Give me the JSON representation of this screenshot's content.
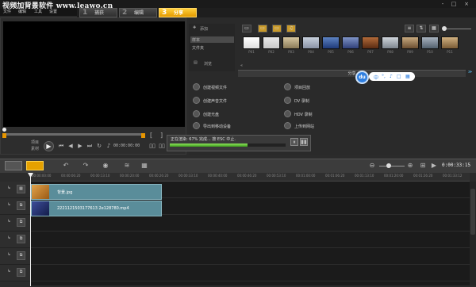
{
  "window": {
    "title": "视频加背景软件 www.leawo.cn",
    "controls": [
      "-",
      "□",
      "×"
    ]
  },
  "menu": [
    "文件",
    "编辑",
    "工具",
    "设置"
  ],
  "steps": [
    {
      "num": "1",
      "label": "捕获"
    },
    {
      "num": "2",
      "label": "编辑"
    },
    {
      "num": "3",
      "label": "分享",
      "active": true
    }
  ],
  "preview": {
    "mode_project": "项目",
    "mode_clip": "素材",
    "timecode": "00:00:00:00",
    "markers": [
      "[",
      "]"
    ]
  },
  "library": {
    "add_label": "添加",
    "items": [
      "样本",
      "文件夹"
    ],
    "browse_label": "浏览",
    "thumbs": [
      "P01",
      "P02",
      "P03",
      "P04",
      "P05",
      "P06",
      "P07",
      "P08",
      "P09",
      "P10",
      "P11"
    ]
  },
  "share": {
    "header": "分享",
    "options_left": [
      "创建视频文件",
      "创建声音文件",
      "创建光盘",
      "导出到移动设备"
    ],
    "options_right": [
      "项目回放",
      "DV 录制",
      "HDV 录制",
      "上传到网站"
    ],
    "render_status": "正在渲染: 67% 完成... 按 ESC 中止.",
    "render_progress": 0.67
  },
  "baidu": {
    "bubble": "du",
    "icons": [
      "中",
      "°,",
      "♪",
      "□",
      "▦"
    ]
  },
  "timeline": {
    "time": "0:00:33",
    "time_frames": "15",
    "ruler": [
      "00:00:00:00",
      "00:00:06:20",
      "00:00:13:10",
      "00:00:20:00",
      "00:00:26:20",
      "00:00:33:10",
      "00:00:40:00",
      "00:00:46:20",
      "00:00:53:10",
      "00:01:00:00",
      "00:01:06:20",
      "00:01:13:10",
      "00:01:20:00",
      "00:01:26:20",
      "00:01:33:12"
    ],
    "clips": [
      {
        "name": "背景.jpg",
        "track": 0
      },
      {
        "name": "2221121503177613 2e128780.mp4",
        "track": 1
      }
    ]
  }
}
